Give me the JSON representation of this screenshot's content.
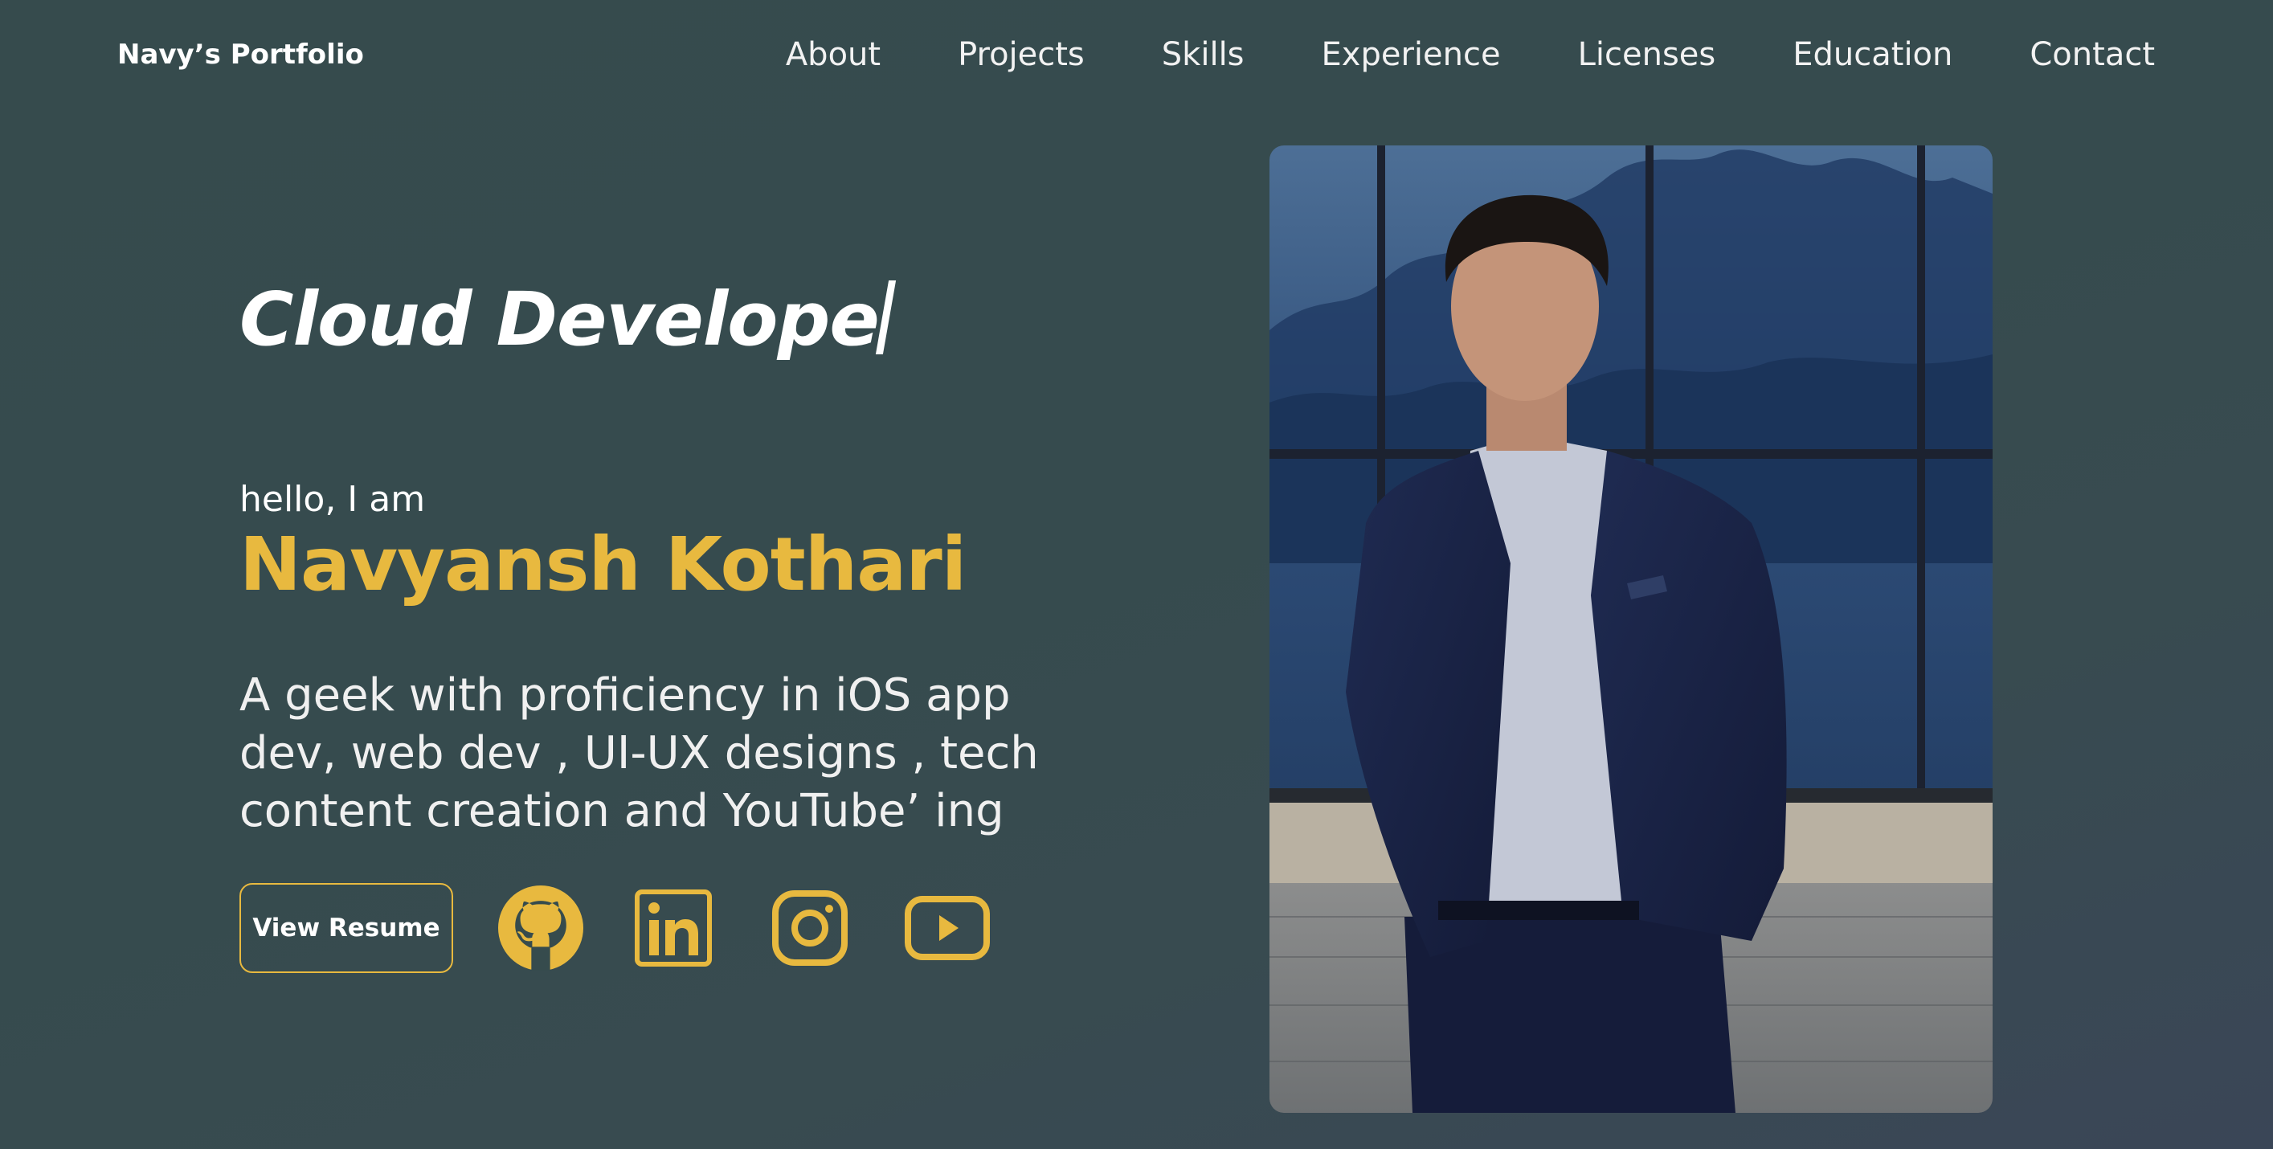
{
  "nav": {
    "brand": "Navy’s Portfolio",
    "items": [
      {
        "label": "About"
      },
      {
        "label": "Projects"
      },
      {
        "label": "Skills"
      },
      {
        "label": "Experience"
      },
      {
        "label": "Licenses"
      },
      {
        "label": "Education"
      },
      {
        "label": "Contact"
      }
    ]
  },
  "hero": {
    "typing_text": "Cloud Develope",
    "greeting": "hello, I am",
    "name": "Navyansh Kothari",
    "description_lines": [
      "A geek with proficiency in iOS app",
      "dev, web dev , UI-UX designs , tech",
      "content creation and YouTube’ ing"
    ],
    "resume_label": "View Resume",
    "socials": [
      "github-icon",
      "linkedin-icon",
      "instagram-icon",
      "youtube-icon"
    ]
  },
  "colors": {
    "accent": "#e8b93f",
    "background": "#364b4d",
    "text": "#ffffff"
  }
}
